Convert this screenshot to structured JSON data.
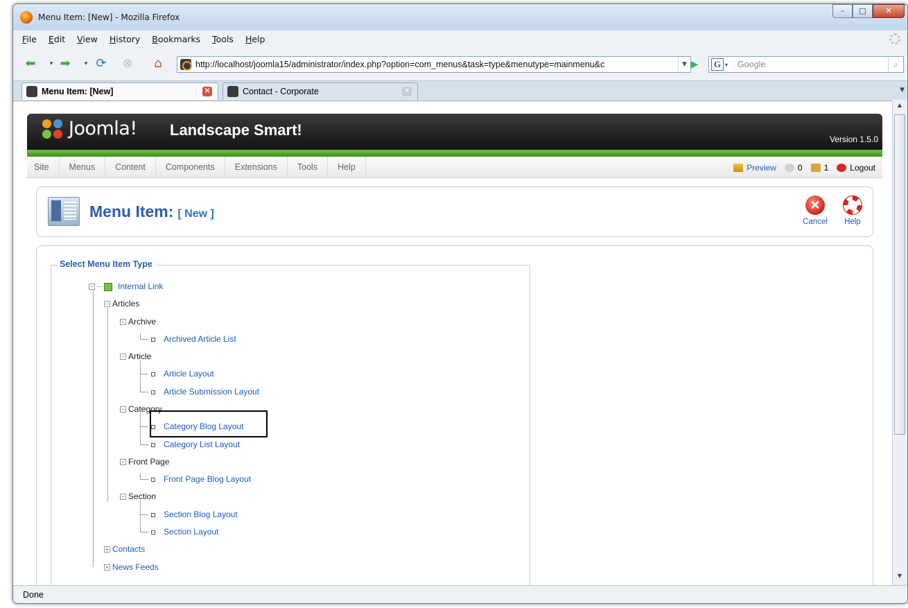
{
  "window": {
    "title": "Menu Item: [New] - Mozilla Firefox",
    "controls": {
      "minimize": "–",
      "maximize": "□",
      "close": "✕"
    }
  },
  "menubar": [
    "File",
    "Edit",
    "View",
    "History",
    "Bookmarks",
    "Tools",
    "Help"
  ],
  "navigation": {
    "url": "http://localhost/joomla15/administrator/index.php?option=com_menus&task=type&menutype=mainmenu&c",
    "search_placeholder": "Google",
    "search_engine_letter": "G"
  },
  "tabs": [
    {
      "label": "Menu Item: [New]",
      "active": true
    },
    {
      "label": "Contact - Corporate",
      "active": false
    }
  ],
  "joomla": {
    "logo_text": "Joomla!",
    "site_name": "Landscape Smart!",
    "version": "Version 1.5.0",
    "menu": [
      "Site",
      "Menus",
      "Content",
      "Components",
      "Extensions",
      "Tools",
      "Help"
    ],
    "status": {
      "preview": "Preview",
      "messages": "0",
      "users": "1",
      "logout": "Logout"
    },
    "page_title": "Menu Item:",
    "page_subtitle": "[ New ]",
    "toolbar": {
      "cancel": "Cancel",
      "help": "Help"
    }
  },
  "select_type": {
    "legend": "Select Menu Item Type",
    "root": "Internal Link",
    "articles": "Articles",
    "archive": "Archive",
    "archived_article_list": "Archived Article List",
    "article": "Article",
    "article_layout": "Article Layout",
    "article_submission_layout": "Article Submission Layout",
    "category": "Category",
    "category_blog_layout": "Category Blog Layout",
    "category_list_layout": "Category List Layout",
    "front_page": "Front Page",
    "front_page_blog_layout": "Front Page Blog Layout",
    "section": "Section",
    "section_blog_layout": "Section Blog Layout",
    "section_layout": "Section Layout",
    "contacts": "Contacts",
    "news_feeds": "News Feeds"
  },
  "statusbar": {
    "text": "Done"
  },
  "colors": {
    "joomla_blue": "#2a5db0",
    "joomla_green": "#6fc23a",
    "link": "#1b5dc0"
  }
}
